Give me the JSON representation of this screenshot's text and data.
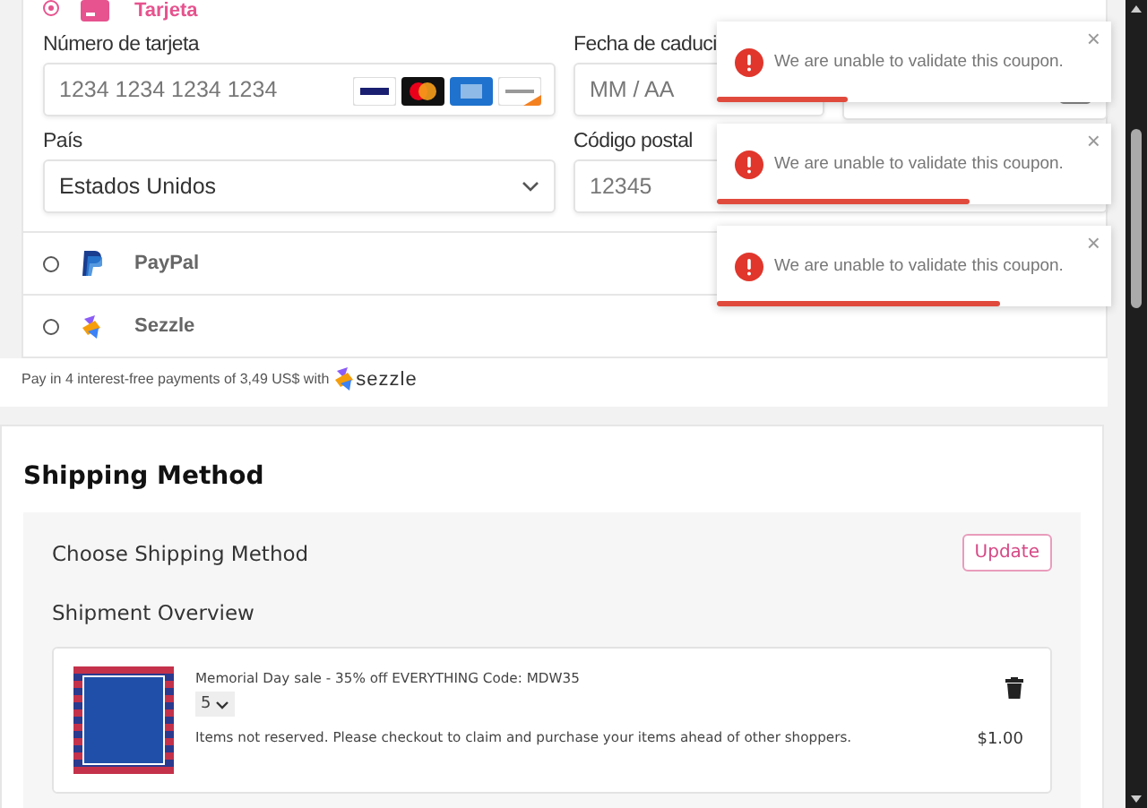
{
  "payment": {
    "methods": [
      {
        "kind": "card",
        "label": "Tarjeta",
        "selected": true
      },
      {
        "kind": "paypal",
        "label": "PayPal",
        "selected": false
      },
      {
        "kind": "sezzle",
        "label": "Sezzle",
        "selected": false
      }
    ],
    "card_number": {
      "label": "Número de tarjeta",
      "placeholder": "1234 1234 1234 1234"
    },
    "expiry": {
      "label": "Fecha de caduci",
      "placeholder": "MM / AA"
    },
    "country": {
      "label": "País",
      "value": "Estados Unidos"
    },
    "postal": {
      "label": "Código postal",
      "placeholder": "12345"
    },
    "installments": {
      "text": "Pay in 4 interest-free payments of 3,49 US$ with",
      "brand": "sezzle"
    }
  },
  "toasts": [
    {
      "message": "We are unable to validate this coupon.",
      "close": "×",
      "level": 0.33
    },
    {
      "message": "We are unable to validate this coupon.",
      "close": "×",
      "level": 0.64
    },
    {
      "message": "We are unable to validate this coupon.",
      "close": "×",
      "level": 0.72
    }
  ],
  "shipping": {
    "title": "Shipping Method",
    "choose_title": "Choose Shipping Method",
    "update_button": "Update",
    "overview_title": "Shipment Overview",
    "item": {
      "name": "Memorial Day sale - 35% off EVERYTHING Code: MDW35",
      "quantity": "5",
      "note": "Items not reserved. Please checkout to claim and purchase your items ahead of other shoppers.",
      "price": "$1.00"
    }
  }
}
